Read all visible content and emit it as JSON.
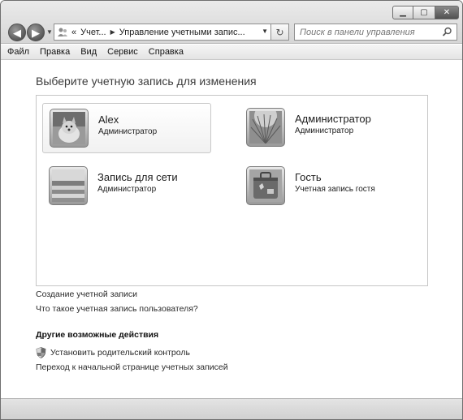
{
  "window": {
    "caption": {
      "minimize": "▁",
      "maximize": "▢",
      "close": "✕"
    }
  },
  "nav": {
    "back_icon": "arrow-left-icon",
    "forward_icon": "arrow-right-icon",
    "address_segments": [
      "Учет...",
      "Управление учетными запис..."
    ],
    "address_prefix": "«",
    "search_placeholder": "Поиск в панели управления"
  },
  "menu": [
    "Файл",
    "Правка",
    "Вид",
    "Сервис",
    "Справка"
  ],
  "main": {
    "title": "Выберите учетную запись для изменения",
    "accounts": [
      {
        "name": "Alex",
        "role": "Администратор",
        "icon": "dog-avatar-icon"
      },
      {
        "name": "Администратор",
        "role": "Администратор",
        "icon": "grass-avatar-icon"
      },
      {
        "name": "Запись для сети",
        "role": "Администратор",
        "icon": "stairs-avatar-icon"
      },
      {
        "name": "Гость",
        "role": "Учетная запись гостя",
        "icon": "suitcase-avatar-icon"
      }
    ],
    "links": {
      "create_account": "Создание учетной записи",
      "what_is_account": "Что такое учетная запись пользователя?"
    },
    "other_actions": {
      "title": "Другие возможные действия",
      "parental_control": "Установить родительский контроль",
      "accounts_home": "Переход к начальной странице учетных записей"
    }
  }
}
